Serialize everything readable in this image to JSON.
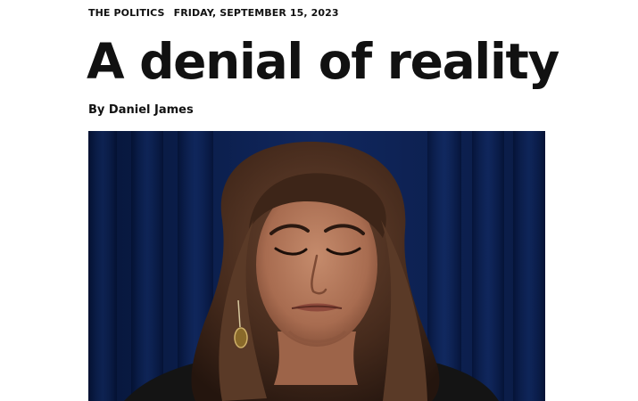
{
  "article": {
    "section": "THE POLITICS",
    "date": "FRIDAY, SEPTEMBER 15, 2023",
    "headline": "A denial of reality",
    "byline_prefix": "By",
    "author": "Daniel James"
  },
  "hero_image": {
    "alt": "A woman with long wavy brown hair, eyes closed and lips pressed together, standing in front of a dark blue curtain",
    "colors": {
      "curtain": "#10275e",
      "hair": "#4a2f1f",
      "skin": "#b07658",
      "jacket": "#141414"
    }
  }
}
